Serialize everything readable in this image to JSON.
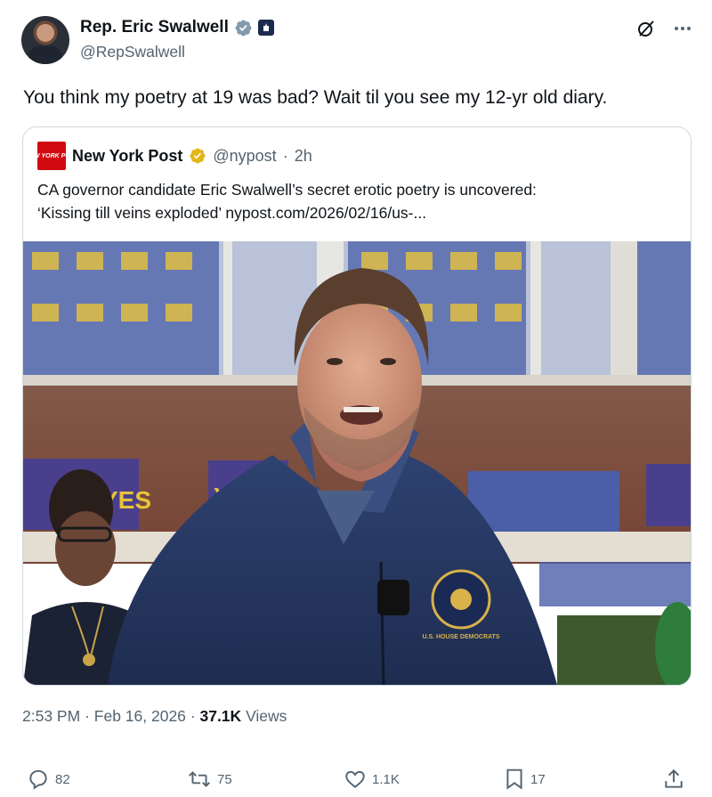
{
  "author": {
    "name": "Rep. Eric Swalwell",
    "handle": "@RepSwalwell",
    "verified_color": "#829aab"
  },
  "tweet": {
    "text": "You think my poetry at 19 was bad?  Wait til you see my 12-yr old diary."
  },
  "quoted": {
    "logo_text": "NEW YORK POST",
    "name": "New York Post",
    "handle": "@nypost",
    "dot": "·",
    "time": "2h",
    "verified_color": "#e2b719",
    "line1": "CA governor candidate Eric Swalwell’s secret erotic poetry is uncovered:",
    "line2": "‘Kissing till veins exploded’ nypost.com/2026/02/16/us-...",
    "image_patch_text": "U.S. HOUSE DEMOCRATS",
    "image_signs": [
      "YES",
      "YES"
    ]
  },
  "meta": {
    "time": "2:53 PM",
    "sep1": "·",
    "date": "Feb 16, 2026",
    "sep2": "·",
    "views_count": "37.1K",
    "views_label": "Views"
  },
  "actions": {
    "replies": "82",
    "reposts": "75",
    "likes": "1.1K",
    "bookmarks": "17"
  },
  "icons": [
    "verified-icon",
    "government-icon",
    "grok-icon",
    "more-icon",
    "reply-icon",
    "repost-icon",
    "like-icon",
    "bookmark-icon",
    "share-icon"
  ]
}
